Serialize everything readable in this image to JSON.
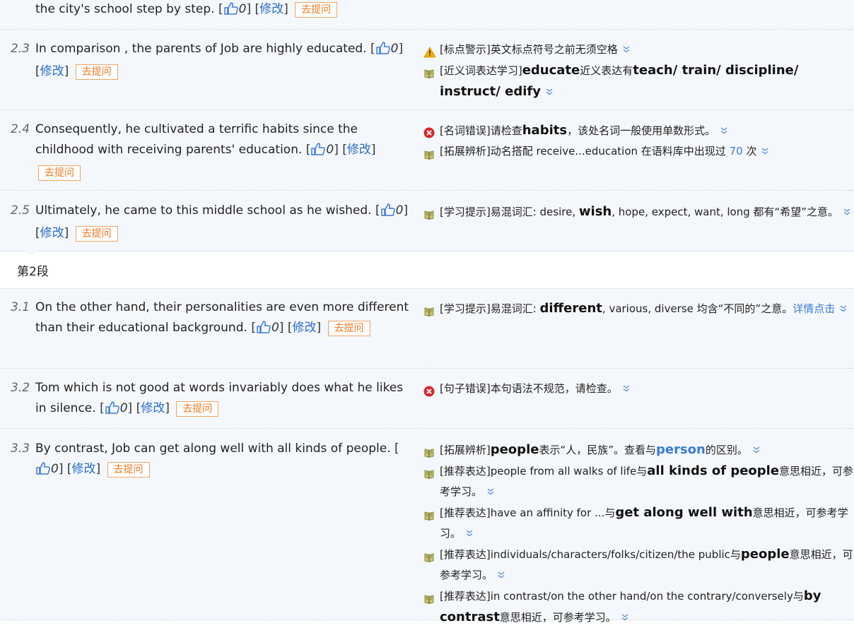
{
  "top_fragment": {
    "text": "the city's school step by step.",
    "likes": "0",
    "modify": "修改",
    "ask": "去提问"
  },
  "rows": [
    {
      "num": "2.3",
      "text": "In comparison , the parents of Job are highly educated.",
      "likes": "0",
      "modify": "修改",
      "ask": "去提问",
      "suggestions": [
        {
          "icon": "warning-icon",
          "tag": "[标点警示]",
          "parts": [
            {
              "t": "英文标点符号之前无须空格"
            }
          ]
        },
        {
          "icon": "book-icon",
          "tag": "[近义词表达学习]",
          "parts": [
            {
              "t": "educate",
              "b": true
            },
            {
              "t": "近义表达有"
            },
            {
              "t": "teach/ train/ discipline/ instruct/ edify",
              "b": true
            }
          ]
        }
      ]
    },
    {
      "num": "2.4",
      "text": "Consequently, he cultivated a terrific habits since the childhood with receiving parents' education.",
      "likes": "0",
      "modify": "修改",
      "ask": "去提问",
      "suggestions": [
        {
          "icon": "error-icon",
          "tag": "[名词错误]",
          "parts": [
            {
              "t": "请检查"
            },
            {
              "t": "habits",
              "b": true
            },
            {
              "t": "，该处名词一般使用单数形式。"
            }
          ]
        },
        {
          "icon": "book-icon",
          "tag": "[拓展辨析]",
          "parts": [
            {
              "t": "动名搭配 receive...education 在语料库中出现过 "
            },
            {
              "t": "70",
              "hl": true
            },
            {
              "t": " 次"
            }
          ]
        }
      ]
    },
    {
      "num": "2.5",
      "text": "Ultimately, he came to this middle school as he wished.",
      "likes": "0",
      "modify": "修改",
      "ask": "去提问",
      "suggestions": [
        {
          "icon": "book-icon",
          "tag": "[学习提示]",
          "parts": [
            {
              "t": "易混词汇: desire, "
            },
            {
              "t": "wish",
              "b": true
            },
            {
              "t": ", hope, expect, want, long 都有“希望”之意。"
            }
          ]
        }
      ]
    },
    {
      "num": "3.1",
      "text": "On the other hand, their personalities are even more different than their educational background.",
      "likes": "0",
      "modify": "修改",
      "ask": "去提问",
      "suggestions": [
        {
          "icon": "book-icon",
          "tag": "[学习提示]",
          "parts": [
            {
              "t": "易混词汇: "
            },
            {
              "t": "different",
              "b": true
            },
            {
              "t": ", various, diverse 均含“不同的”之意。"
            },
            {
              "t": "详情点击",
              "hl": true
            }
          ]
        }
      ]
    },
    {
      "num": "3.2",
      "text": "Tom which is not good at words invariably does what he likes in silence.",
      "likes": "0",
      "modify": "修改",
      "ask": "去提问",
      "suggestions": [
        {
          "icon": "error-icon",
          "tag": "[句子错误]",
          "parts": [
            {
              "t": "本句语法不规范，请检查。"
            }
          ]
        }
      ]
    },
    {
      "num": "3.3",
      "text": "By contrast, Job can get along well with all kinds of people.",
      "likes": "0",
      "modify": "修改",
      "ask": "去提问",
      "suggestions": [
        {
          "icon": "book-icon",
          "tag": "[拓展辨析]",
          "parts": [
            {
              "t": "people",
              "b": true
            },
            {
              "t": "表示“人，民族”。查看与"
            },
            {
              "t": "person",
              "b": true,
              "blue": true
            },
            {
              "t": "的区别。"
            }
          ]
        },
        {
          "icon": "book-icon",
          "tag": "[推荐表达]",
          "parts": [
            {
              "t": "people from all walks of life与"
            },
            {
              "t": "all kinds of people",
              "b": true
            },
            {
              "t": "意思相近，可参考学习。"
            }
          ]
        },
        {
          "icon": "book-icon",
          "tag": "[推荐表达]",
          "parts": [
            {
              "t": "have an affinity for ...与"
            },
            {
              "t": "get along well with",
              "b": true
            },
            {
              "t": "意思相近，可参考学习。"
            }
          ]
        },
        {
          "icon": "book-icon",
          "tag": "[推荐表达]",
          "parts": [
            {
              "t": "individuals/characters/folks/citizen/the public与"
            },
            {
              "t": "people",
              "b": true
            },
            {
              "t": "意思相近，可参考学习。"
            }
          ]
        },
        {
          "icon": "book-icon",
          "tag": "[推荐表达]",
          "parts": [
            {
              "t": "in contrast/on the other hand/on the contrary/conversely与"
            },
            {
              "t": "by contrast",
              "b": true
            },
            {
              "t": "意思相近，可参考学习。"
            }
          ]
        }
      ]
    }
  ],
  "paragraph_label": "第2段"
}
